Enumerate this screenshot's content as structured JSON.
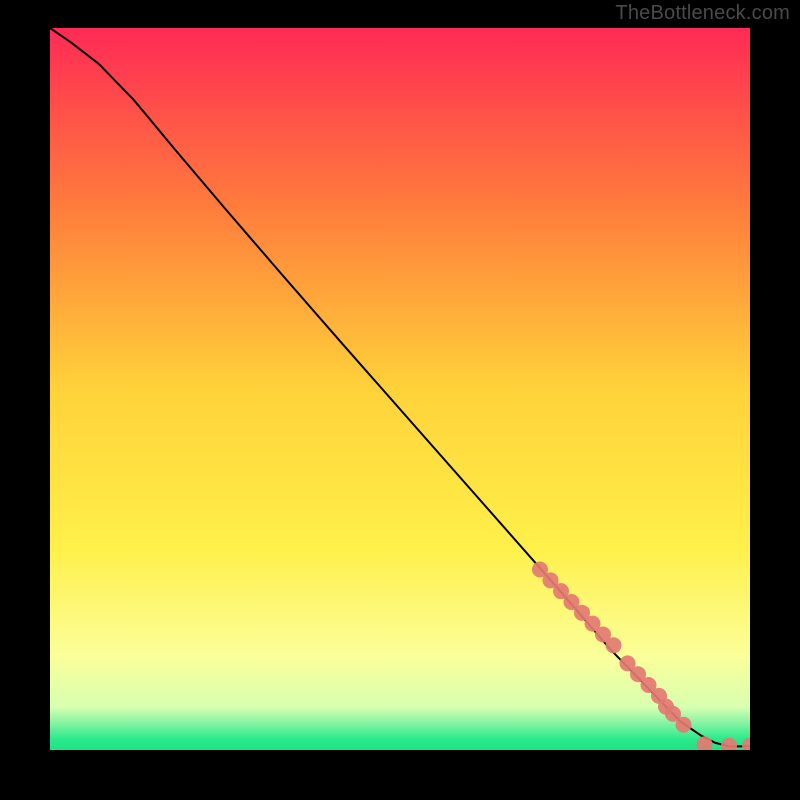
{
  "watermark": "TheBottleneck.com",
  "colors": {
    "gradient_top": "#ff2a55",
    "gradient_mid_upper": "#ff7d3c",
    "gradient_mid": "#ffd23a",
    "gradient_mid_lower": "#fff04a",
    "gradient_lower": "#fbff9a",
    "gradient_green": "#2bea8a",
    "line": "#000000",
    "marker": "#e37a72",
    "bg": "#000000"
  },
  "chart_data": {
    "type": "line",
    "title": "",
    "xlabel": "",
    "ylabel": "",
    "xlim": [
      0,
      100
    ],
    "ylim": [
      0,
      100
    ],
    "legend": false,
    "grid": false,
    "series": [
      {
        "name": "curve",
        "x": [
          0,
          3,
          7,
          12,
          18,
          25,
          33,
          42,
          52,
          62,
          72,
          80,
          86,
          90,
          93,
          95,
          97,
          100
        ],
        "y": [
          100,
          98,
          95,
          90,
          83,
          75,
          66,
          56,
          45,
          34,
          23,
          14,
          8,
          4,
          2,
          1,
          0.5,
          0.5
        ]
      }
    ],
    "markers": {
      "name": "dots",
      "x": [
        70,
        71.5,
        73,
        74.5,
        76,
        77.5,
        79,
        80.5,
        82.5,
        84,
        85.5,
        87,
        88,
        89,
        90.5,
        93.5,
        97,
        100
      ],
      "y": [
        25,
        23.5,
        22,
        20.5,
        19,
        17.5,
        16,
        14.5,
        12,
        10.5,
        9,
        7.5,
        6,
        5,
        3.5,
        0.8,
        0.6,
        0.6
      ]
    }
  }
}
